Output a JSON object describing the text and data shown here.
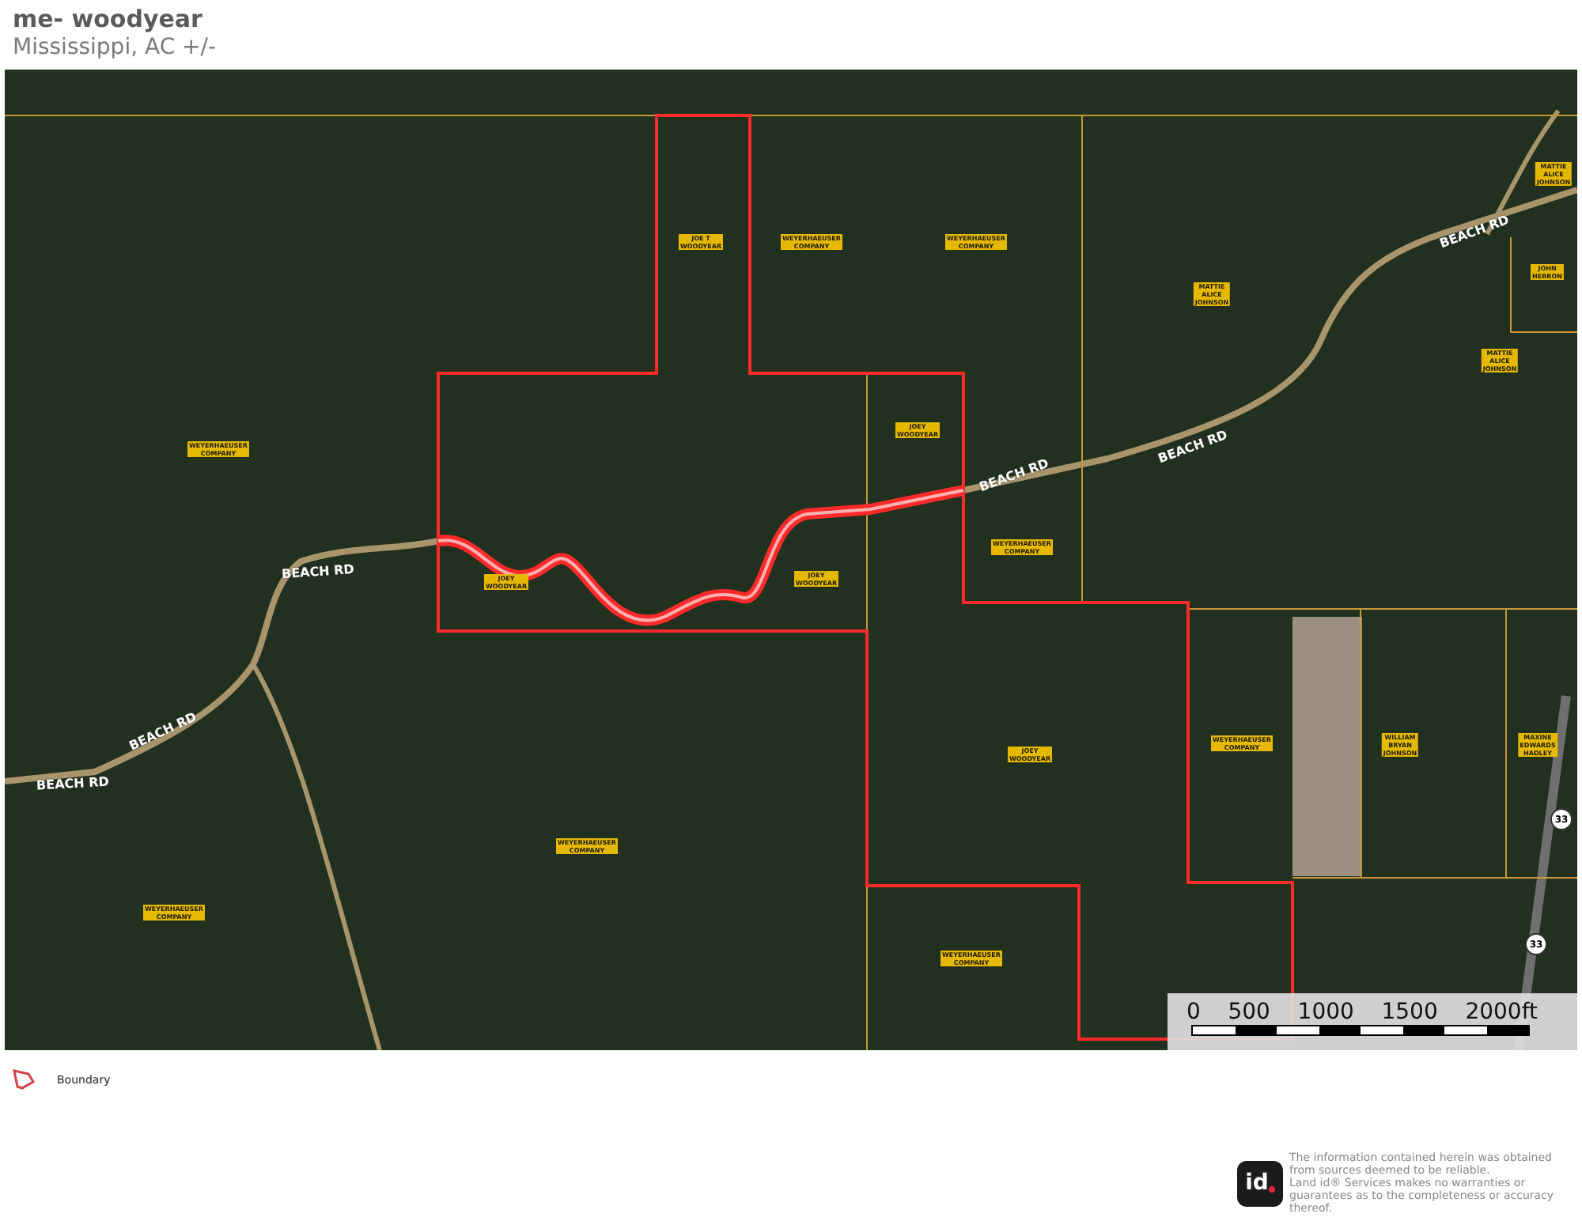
{
  "header": {
    "title": "me- woodyear",
    "subtitle": "Mississippi,  AC +/-"
  },
  "map": {
    "parcel_labels": [
      {
        "text": "JOE T\nWOODYEAR"
      },
      {
        "text": "WEYERHAEUSER\nCOMPANY"
      },
      {
        "text": "WEYERHAEUSER\nCOMPANY"
      },
      {
        "text": "MATTIE\nALICE\nJOHNSON"
      },
      {
        "text": "MATTIE\nALICE\nJOHNSON"
      },
      {
        "text": "JOHN\nHERRON"
      },
      {
        "text": "MATTIE\nALICE\nJOHNSON"
      },
      {
        "text": "WEYERHAEUSER\nCOMPANY"
      },
      {
        "text": "JOEY\nWOODYEAR"
      },
      {
        "text": "WEYERHAEUSER\nCOMPANY"
      },
      {
        "text": "JOEY\nWOODYEAR"
      },
      {
        "text": "JOEY\nWOODYEAR"
      },
      {
        "text": "JOEY\nWOODYEAR"
      },
      {
        "text": "WEYERHAEUSER\nCOMPANY"
      },
      {
        "text": "WILLIAM\nBRYAN\nJOHNSON"
      },
      {
        "text": "MAXINE\nEDWARDS\nHADLEY"
      },
      {
        "text": "WEYERHAEUSER\nCOMPANY"
      },
      {
        "text": "WEYERHAEUSER\nCOMPANY"
      },
      {
        "text": "WEYERHAEUSER\nCOMPANY"
      }
    ],
    "road_labels": [
      {
        "text": "BEACH RD"
      },
      {
        "text": "BEACH RD"
      },
      {
        "text": "BEACH RD"
      },
      {
        "text": "BEACH RD"
      },
      {
        "text": "BEACH RD"
      },
      {
        "text": "BEACH RD"
      }
    ],
    "route_shields": [
      {
        "text": "33"
      },
      {
        "text": "33"
      }
    ],
    "scale_bar": {
      "labels": [
        "0",
        "500",
        "1000",
        "1500",
        "2000ft"
      ]
    }
  },
  "legend": [
    {
      "label": "Boundary"
    }
  ],
  "disclaimer": {
    "logo": "id",
    "text": "The information contained herein was obtained from sources deemed to be reliable.\n  Land id® Services makes no warranties or guarantees as to the completeness or accuracy thereof."
  }
}
